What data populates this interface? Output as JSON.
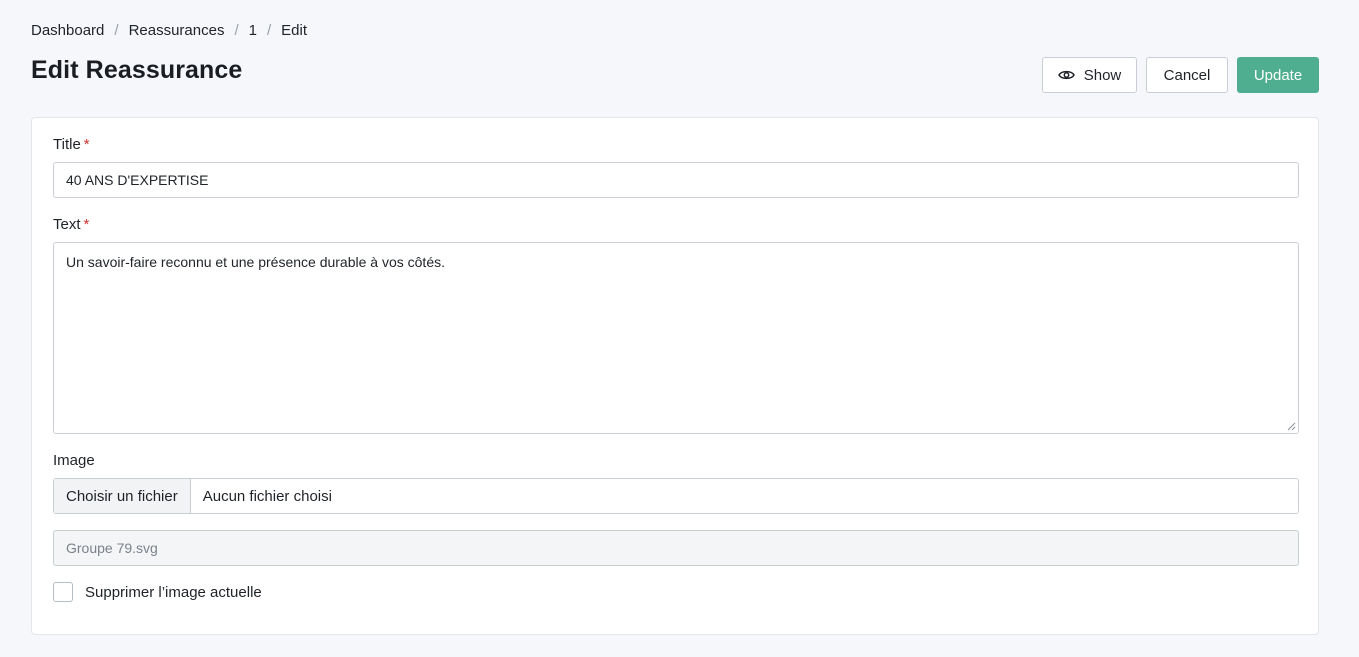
{
  "breadcrumb": {
    "items": [
      "Dashboard",
      "Reassurances",
      "1",
      "Edit"
    ],
    "separator": "/"
  },
  "page": {
    "title": "Edit Reassurance"
  },
  "actions": {
    "show_label": "Show",
    "cancel_label": "Cancel",
    "update_label": "Update"
  },
  "form": {
    "title": {
      "label": "Title",
      "required_mark": "*",
      "value": "40 ANS D'EXPERTISE"
    },
    "text": {
      "label": "Text",
      "required_mark": "*",
      "value": "Un savoir-faire reconnu et une présence durable à vos côtés."
    },
    "image": {
      "label": "Image",
      "choose_label": "Choisir un fichier",
      "no_file_label": "Aucun fichier choisi",
      "current_file": "Groupe 79.svg",
      "delete_label": "Supprimer l’image actuelle",
      "delete_checked": false
    }
  },
  "colors": {
    "primary": "#4fae8f",
    "required": "#d0312d",
    "background": "#f6f7fa"
  },
  "icons": {
    "show": "eye-icon"
  }
}
